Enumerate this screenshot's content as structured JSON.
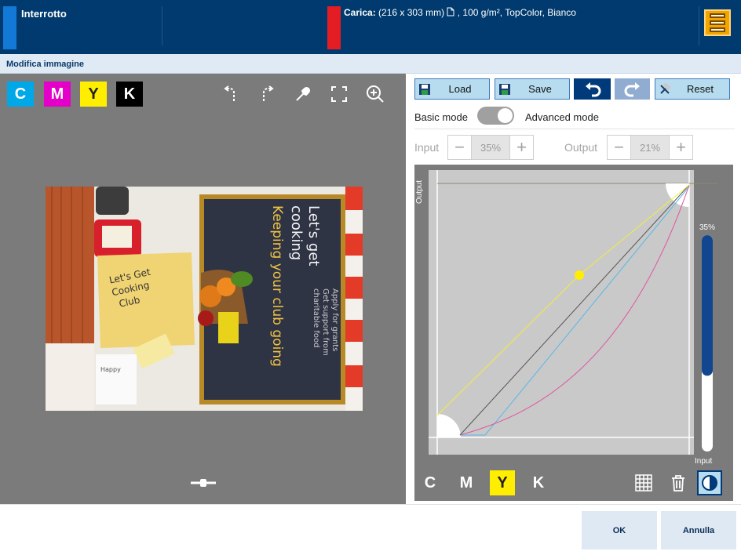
{
  "topbar": {
    "status_label": "Interrotto",
    "status_color": "#1279d6",
    "load_prefix": "Carica:",
    "load_size": "(216 x 303 mm)",
    "load_details": ", 100 g/m², TopColor, Bianco",
    "load_color": "#e41c24",
    "menu_icon": "queue-menu-icon"
  },
  "title": "Modifica immagine",
  "preview": {
    "channels": [
      "C",
      "M",
      "Y",
      "K"
    ],
    "tools": [
      "rotate-left-icon",
      "rotate-right-icon",
      "eyedropper-icon",
      "fit-screen-icon",
      "zoom-in-icon"
    ],
    "artwork": {
      "headline": "Let's get cooking",
      "slogan": "Keeping your club going",
      "subtext": "Apply for grants. Get support from charitable food",
      "note": "Let's Get Cooking Club",
      "badge": "Happy"
    }
  },
  "editor": {
    "buttons": {
      "load": "Load",
      "save": "Save",
      "reset": "Reset"
    },
    "mode": {
      "basic": "Basic mode",
      "advanced": "Advanced mode"
    },
    "input": {
      "label": "Input",
      "value": "35%"
    },
    "output": {
      "label": "Output",
      "value": "21%"
    },
    "curve": {
      "axis_output": "Output",
      "axis_input": "Input",
      "level_label": "35%",
      "level_value": 0.35,
      "colors": {
        "cyan": "#55b8e6",
        "magenta": "#e0559e",
        "yellow": "#f1ef3c",
        "black": "#555555"
      }
    },
    "channels": [
      "C",
      "M",
      "Y",
      "K"
    ],
    "active_channel": "Y"
  },
  "actions": {
    "ok": "OK",
    "cancel": "Annulla"
  }
}
